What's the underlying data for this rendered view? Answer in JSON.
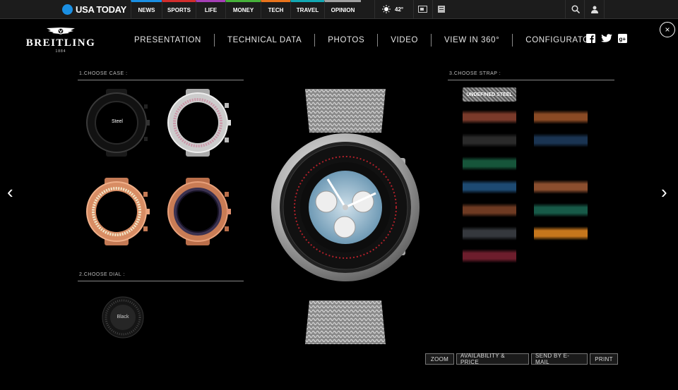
{
  "usatoday": {
    "logo": "USA TODAY",
    "nav": [
      {
        "label": "NEWS",
        "color": "#1a8fe3"
      },
      {
        "label": "SPORTS",
        "color": "#d22d2d"
      },
      {
        "label": "LIFE",
        "color": "#a53fb6"
      },
      {
        "label": "MONEY",
        "color": "#46b13a"
      },
      {
        "label": "TECH",
        "color": "#e8731c"
      },
      {
        "label": "TRAVEL",
        "color": "#12a7b2"
      },
      {
        "label": "OPINION",
        "color": "#a0a0a0"
      }
    ],
    "temperature": "42°"
  },
  "breitling": {
    "brand": "BREITLING",
    "year": "1884",
    "nav": [
      "PRESENTATION",
      "TECHNICAL DATA",
      "PHOTOS",
      "VIDEO",
      "VIEW IN 360°",
      "CONFIGURATOR"
    ],
    "close": "×"
  },
  "case_section": {
    "title": "1.CHOOSE CASE :",
    "cases": [
      {
        "label": "Steel",
        "finish": "black"
      },
      {
        "label": "",
        "finish": "steel"
      },
      {
        "label": "",
        "finish": "red-gold"
      },
      {
        "label": "",
        "finish": "red-gold-dark"
      }
    ]
  },
  "dial_section": {
    "title": "2.CHOOSE DIAL :",
    "dials": [
      {
        "label": "Black"
      }
    ]
  },
  "strap_section": {
    "title": "3.CHOOSE STRAP :",
    "selected": "UNDEFINED STEEL",
    "straps": [
      {
        "color": "#7a3a2a"
      },
      {
        "color": "#8a4a24"
      },
      {
        "color": "#2a2a2a"
      },
      {
        "color": "#1a3452"
      },
      {
        "color": "#16553a"
      },
      {
        "color": "#1d4a72"
      },
      {
        "color": "#8b4e2e"
      },
      {
        "color": "#6e3a22"
      },
      {
        "color": "#175a48"
      },
      {
        "color": "#35383d"
      },
      {
        "color": "#c6761c"
      },
      {
        "color": "#6d1d2c"
      }
    ]
  },
  "actions": [
    "ZOOM",
    "AVAILABILITY & PRICE",
    "SEND BY E-MAIL",
    "PRINT"
  ],
  "arrows": {
    "prev": "‹",
    "next": "›"
  }
}
